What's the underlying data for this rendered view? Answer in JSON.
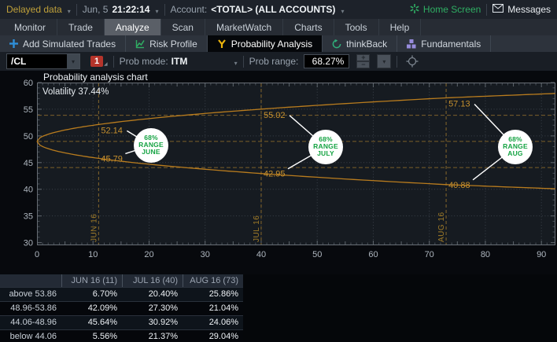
{
  "top_bar": {
    "delayed_data": "Delayed data",
    "date": "Jun, 5",
    "time": "21:22:14",
    "account_label": "Account:",
    "account_value": "<TOTAL> (ALL ACCOUNTS)",
    "home_screen_label": "Home Screen",
    "messages_label": "Messages"
  },
  "menu": {
    "items": [
      "Monitor",
      "Trade",
      "Analyze",
      "Scan",
      "MarketWatch",
      "Charts",
      "Tools",
      "Help"
    ],
    "active": "Analyze"
  },
  "subtabs": {
    "items": [
      {
        "label": "Add Simulated Trades",
        "icon": "plus-icon",
        "active": false
      },
      {
        "label": "Risk Profile",
        "icon": "risk-profile-icon",
        "active": false
      },
      {
        "label": "Probability Analysis",
        "icon": "probability-icon",
        "active": true
      },
      {
        "label": "thinkBack",
        "icon": "thinkback-icon",
        "active": false
      },
      {
        "label": "Fundamentals",
        "icon": "fundamentals-icon",
        "active": false
      }
    ]
  },
  "controls": {
    "symbol": "/CL",
    "alert_badge": "1",
    "prob_mode_label": "Prob mode:",
    "prob_mode_value": "ITM",
    "prob_range_label": "Prob range:",
    "prob_range_value": "68.27%"
  },
  "chart_data": {
    "type": "line",
    "title": "Probability analysis chart",
    "annotation": "Volatility 37.44%",
    "xlim": [
      0,
      92.5
    ],
    "ylim": [
      29.5,
      60
    ],
    "x_ticks": [
      0,
      10,
      20,
      30,
      40,
      50,
      60,
      70,
      80,
      90
    ],
    "y_ticks": [
      30,
      35,
      40,
      45,
      50,
      55,
      60
    ],
    "grid": "dotted",
    "legend": "none",
    "price_levels": [
      53.86,
      48.96,
      44.06
    ],
    "curve_color": "#b97c1e",
    "badge_text_color": "#14a342",
    "series": [
      {
        "name": "upper-68pct-band",
        "points": [
          [
            0,
            48.96
          ],
          [
            11,
            52.14
          ],
          [
            40,
            55.02
          ],
          [
            73,
            57.13
          ],
          [
            92.5,
            57.95
          ]
        ]
      },
      {
        "name": "lower-68pct-band",
        "points": [
          [
            0,
            48.96
          ],
          [
            11,
            45.79
          ],
          [
            40,
            42.95
          ],
          [
            73,
            40.88
          ],
          [
            92.5,
            40.1
          ]
        ]
      }
    ],
    "events": [
      {
        "x": 11,
        "axis_label": "JUN 16",
        "upper": "52.14",
        "lower": "45.79",
        "badge": [
          "68%",
          "RANGE",
          "JUNE"
        ]
      },
      {
        "x": 40,
        "axis_label": "JUL 16",
        "upper": "55.02",
        "lower": "42.95",
        "badge": [
          "68%",
          "RANGE",
          "JULY"
        ]
      },
      {
        "x": 73,
        "axis_label": "AUG 16",
        "upper": "57.13",
        "lower": "40.88",
        "badge": [
          "68%",
          "RANGE",
          "AUG"
        ]
      }
    ]
  },
  "table": {
    "headers": [
      "",
      "JUN 16 (11)",
      "JUL 16 (40)",
      "AUG 16 (73)"
    ],
    "rows": [
      {
        "label": "above 53.86",
        "values": [
          "6.70%",
          "20.40%",
          "25.86%"
        ]
      },
      {
        "label": "48.96-53.86",
        "values": [
          "42.09%",
          "27.30%",
          "21.04%"
        ]
      },
      {
        "label": "44.06-48.96",
        "values": [
          "45.64%",
          "30.92%",
          "24.06%"
        ]
      },
      {
        "label": "below 44.06",
        "values": [
          "5.56%",
          "21.37%",
          "29.04%"
        ]
      }
    ]
  }
}
